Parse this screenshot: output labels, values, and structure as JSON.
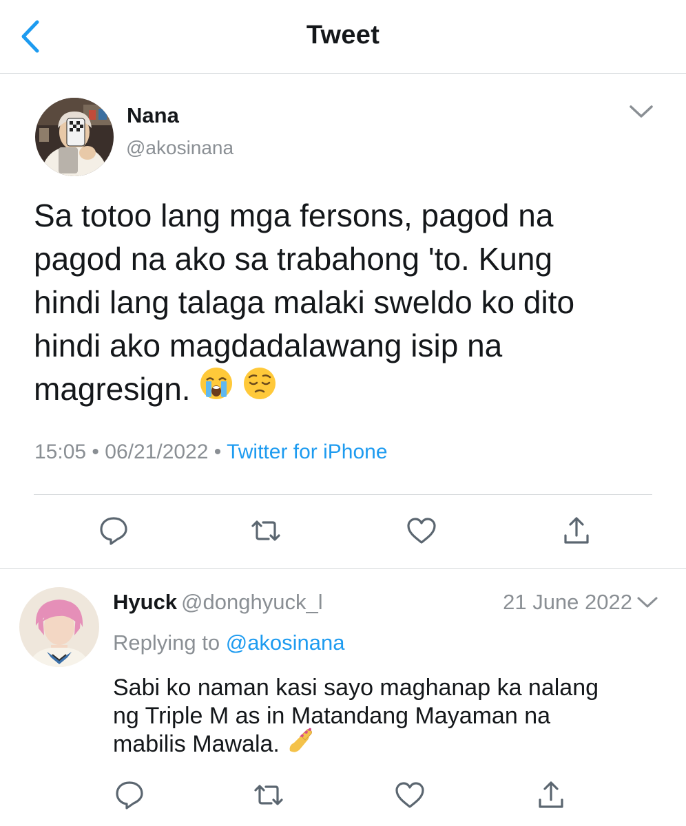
{
  "header": {
    "title": "Tweet",
    "back_icon": "chevron-left-icon",
    "accent_color": "#1d9bf0"
  },
  "tweet": {
    "author": {
      "name": "Nana",
      "handle": "@akosinana"
    },
    "text_lines": [
      "Sa totoo lang mga fersons, pagod na",
      "pagod na ako sa trabahong 'to. Kung",
      "hindi lang talaga malaki sweldo ko dito",
      "hindi ako magdadalawang isip na",
      "magresign."
    ],
    "emojis": [
      "loudly-crying-face-emoji",
      "pensive-face-emoji"
    ],
    "time": "15:05",
    "date": "06/21/2022",
    "separator": "•",
    "source": "Twitter for iPhone",
    "actions": [
      "reply-icon",
      "retweet-icon",
      "like-icon",
      "share-icon"
    ]
  },
  "reply": {
    "author": {
      "name": "Hyuck",
      "handle": "@donghyuck_l"
    },
    "date": "21 June 2022",
    "replying_prefix": "Replying to",
    "replying_to": "@akosinana",
    "text_lines": [
      "Sabi ko naman kasi sayo maghanap ka nalang",
      "ng Triple M as in Matandang Mayaman na",
      "mabilis Mawala."
    ],
    "emoji": "nail-polish-emoji",
    "actions": [
      "reply-icon",
      "retweet-icon",
      "like-icon",
      "share-icon"
    ]
  }
}
